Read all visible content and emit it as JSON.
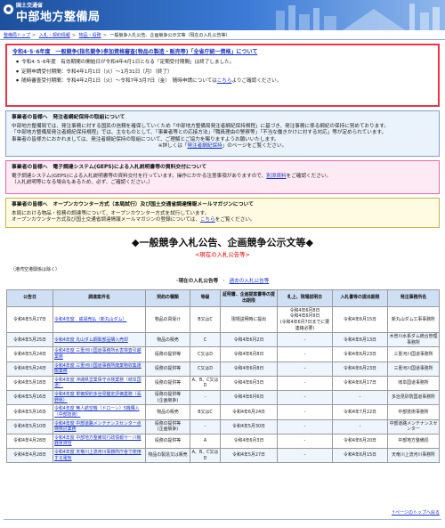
{
  "header": {
    "ministry": "国土交通省",
    "bureau": "中部地方整備局"
  },
  "breadcrumb": [
    "整備局トップ",
    "入札・契約情報",
    "物品・役務",
    "一般競争入札公告、企画競争公示文等（現在の入札公告等）"
  ],
  "notices": {
    "red": {
      "title": "令和4･5･6年度　一般競争(指名競争)参加資格審査(物品の製造・販売等)「全省庁統一資格」について",
      "items": [
        "令和4･5･6年度　有効期間の開始日が令和4年4月1日となる「定期受付期間」は終了しました。",
        "定期申請受付期間：令和4年1月1日（火）～1月31日（月）（終了）",
        "随時審査受付期間：令和4年2月1日（火）～令和7年3月7日（金）　随時申請については"
      ],
      "link_text": "こちら",
      "link_after": "よりご確認ください。"
    },
    "blue": {
      "title": "事業者の皆様へ　発注者綱紀保持の取組について",
      "body1": "中部地方整備局では、発注事務に対する国民の信頼を確保していくため「中部地方整備局発注者綱紀保持規程」に基づき、発注事務に係る綱紀の保持に努めております。",
      "body2": "「中部地方整備局発注者綱紀保持規程」では、主なものとして、「事業者等との応接方法」「職員理由の警察等」「不当な働きかけに対する対応」等が定められています。",
      "body3": "事業者の皆様方におかれましては、発注者綱紀保持の取組について、ご理解とご協力を賜りますようお願いいたします。",
      "more_prefix": "※詳しくは「",
      "more_link": "発注者綱紀保持",
      "more_suffix": "」のページをご覧ください。"
    },
    "pink": {
      "title": "事業者の皆様へ　電子調達システム(GEPS)による入札説明書等の資料交付について",
      "body1": "電子調達システム(GEPS)による入札説明書等の資料交付を行っています。操作にかかる注意事項がありますので、",
      "link": "別添資料",
      "body1b": "をご確認ください。",
      "body2": "（入札説明等になる場合もあるため、必ず、ご確認ください。）"
    },
    "yellow": {
      "title": "事業者の皆様へ　オープンカウンター方式（本局試行）及び国土交通省調達情報メールマガジンについて",
      "body1": "本局における物品・役務の調達等について、オープンカウンター方式を試行しています。",
      "body2": "オープンカウンター方式及び国土交通省調達情報メールマガジンの登録については、",
      "link": "こちら",
      "body2b": "をご覧ください。"
    }
  },
  "section": {
    "title": "◆一般競争入札公告、企画競争公示文等◆",
    "subtitle": "<現在の入札公告等>",
    "jv_note": "（港湾空港関係は除く）"
  },
  "tabs": {
    "current": "･現在の入札公告等",
    "sep": "･",
    "past": "過去の入札公告等"
  },
  "table": {
    "headers": [
      "公告日",
      "調達案件名",
      "契約の種類",
      "等級",
      "証明書、企画提案書等の提出期限",
      "札上、現場説明日",
      "入札書等の提出期限",
      "発注事務所名"
    ],
    "rows": [
      [
        "令和4年5月27日",
        "令和4年度　鉄屑売払（新丸山ダム）",
        "物品の買受け",
        "B又はC",
        "現場説明時に提出",
        "令和4年6月8日\n令和4年6月9日\n(令和4年6月7日までに要連絡必要)",
        "令和4年6月15日",
        "新丸山ダム工事事務所"
      ],
      [
        "令和4年5月25日",
        "令和4年度 丸山ダム鋼製部品購入売却",
        "物品の販売",
        "C",
        "令和4年6月2日",
        "-",
        "令和4年6月13日",
        "木曽川水系ダム統合管理事務所"
      ],
      [
        "令和4年5月24日",
        "令和4年度 三重河川国道事務所水害検査引越業務",
        "役務の提供等",
        "C又はD",
        "令和4年6月8日",
        "-",
        "令和4年6月23日",
        "三重河川国道事務所"
      ],
      [
        "令和4年5月24日",
        "令和4年度 三重河川国道事務所廃棄物収集運搬業務",
        "役務の提供等",
        "C又はD",
        "令和4年6月8日",
        "-",
        "令和4年6月23日",
        "三重河川国道事務所"
      ],
      [
        "令和4年5月18日",
        "令和4年度 沖縄県営業保守点検業務（岐阜国道）",
        "役務の提供等",
        "A、B、C又はD",
        "令和4年6月3日",
        "-",
        "令和4年6月17日",
        "岐阜国道事務所"
      ],
      [
        "令和4年5月16日",
        "令和4年度 単価契約多治見鑑定評価業務（長野県）",
        "役務の提供等\n(企画競争)",
        "-",
        "令和4年6月6日",
        "-",
        "-",
        "多治見砂防国道事務所"
      ],
      [
        "令和4年5月16日",
        "令和4年度 無人航空機（ドローン）5機購入（中部技術）",
        "物品の販売",
        "B又はC",
        "令和4年6月24日",
        "-",
        "令和4年7月22日",
        "中部技術事務所"
      ],
      [
        "令和4年5月10日",
        "令和4年度 中部道路メンテナンスセンター点検検討業務",
        "役務の提供等\n(企画競争)",
        "-",
        "令和4年5月30日",
        "-",
        "-",
        "中部道路メンテナンスセンター"
      ],
      [
        "令和4年4月28日",
        "令和4年度 中部地方整備局行政情報サーバ機器賃貸借",
        "役務の提供等",
        "A",
        "令和4年6月3日",
        "-",
        "令和4年6月20日",
        "中部地方整備局"
      ],
      [
        "令和4年4月28日",
        "令和4年度 天竜川上流河川事務所庁舎で使用する電気",
        "物品の製造又は販売",
        "A、B、C又はD",
        "令和4年5月27日",
        "-",
        "令和4年6月15日",
        "天竜川上流河川事務所"
      ]
    ]
  },
  "footer": {
    "top_link": "↑ページのトップへ戻る"
  }
}
